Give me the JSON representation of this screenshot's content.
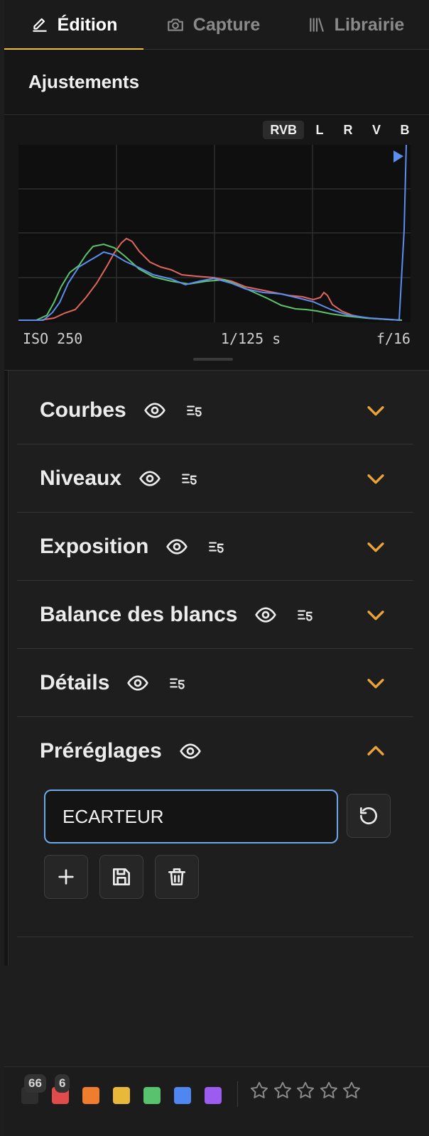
{
  "tabs": [
    {
      "label": "Édition",
      "icon": "pencil-icon",
      "active": true
    },
    {
      "label": "Capture",
      "icon": "camera-icon",
      "active": false
    },
    {
      "label": "Librairie",
      "icon": "library-icon",
      "active": false
    }
  ],
  "panel": {
    "title": "Ajustements"
  },
  "histogram": {
    "channels": [
      "RVB",
      "L",
      "R",
      "V",
      "B"
    ],
    "active_channel": "RVB",
    "colors": {
      "red": "#e0665c",
      "green": "#5cc46a",
      "blue": "#5b8ef0"
    }
  },
  "exif": {
    "iso": "ISO 250",
    "shutter": "1/125 s",
    "aperture": "f/16"
  },
  "sections": [
    {
      "label": "Courbes",
      "expanded": false
    },
    {
      "label": "Niveaux",
      "expanded": false
    },
    {
      "label": "Exposition",
      "expanded": false
    },
    {
      "label": "Balance des blancs",
      "expanded": false
    },
    {
      "label": "Détails",
      "expanded": false
    },
    {
      "label": "Préréglages",
      "expanded": true
    }
  ],
  "presets": {
    "current_value": "ECARTEUR"
  },
  "footer": {
    "color_labels": [
      {
        "color": "#2e2e2e",
        "count": "66"
      },
      {
        "color": "#e24b4b",
        "count": "6"
      },
      {
        "color": "#ef7d2f"
      },
      {
        "color": "#e8b83a"
      },
      {
        "color": "#58c26e"
      },
      {
        "color": "#4f86f0"
      },
      {
        "color": "#9d5cf0"
      }
    ],
    "rating": 0,
    "max_rating": 5
  },
  "colors": {
    "accent": "#e9c13e",
    "chevron": "#e8a33a",
    "focus": "#6fa8e8"
  }
}
